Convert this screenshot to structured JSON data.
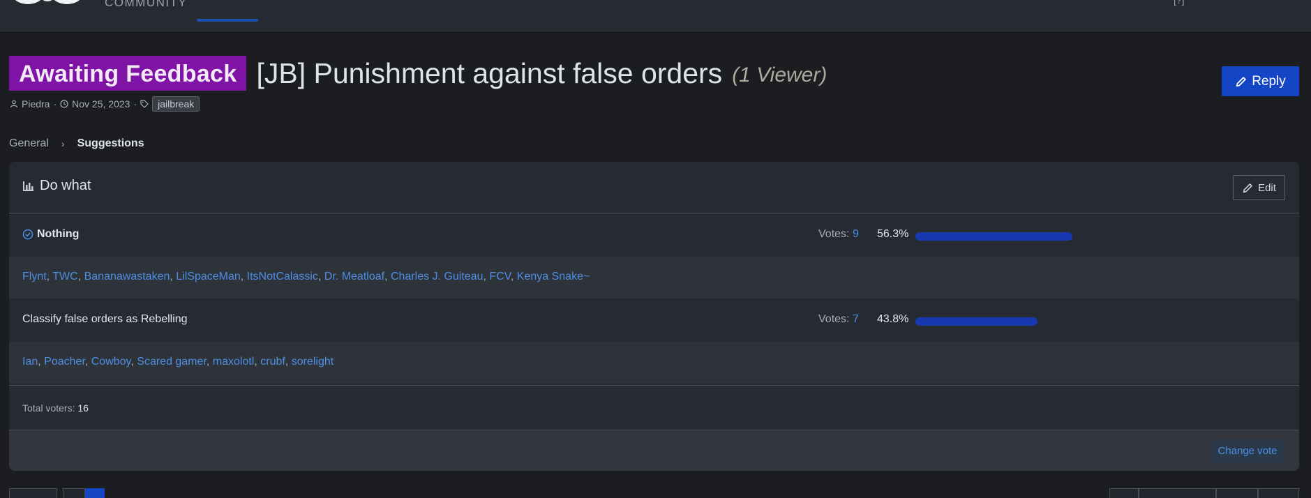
{
  "header": {
    "community_text": "COMMUNITY",
    "top_right_text": "[?]"
  },
  "thread": {
    "prefix_badge": "Awaiting Feedback",
    "title": "[JB] Punishment against false orders",
    "viewer_note": "(1 Viewer)",
    "reply_label": "Reply",
    "author": "Piedra",
    "separator": "·",
    "date": "Nov 25, 2023",
    "tag": "jailbreak"
  },
  "breadcrumb": {
    "items": [
      "General",
      "Suggestions"
    ]
  },
  "poll": {
    "question": "Do what",
    "edit_label": "Edit",
    "votes_label": "Votes:",
    "options": [
      {
        "label": "Nothing",
        "votes": "9",
        "percent": "56.3%",
        "fraction": 0.563,
        "voted": true,
        "voters": [
          "Flynt",
          "TWC",
          "Bananawastaken",
          "LilSpaceMan",
          "ItsNotCalassic",
          "Dr. Meatloaf",
          "Charles J. Guiteau",
          "FCV",
          "Kenya Snake~"
        ]
      },
      {
        "label": "Classify false orders as Rebelling",
        "votes": "7",
        "percent": "43.8%",
        "fraction": 0.438,
        "voted": false,
        "voters": [
          "Ian",
          "Poacher",
          "Cowboy",
          "Scared gamer",
          "maxolotl",
          "crubf",
          "sorelight"
        ]
      }
    ],
    "total_label": "Total voters:",
    "total_value": "16",
    "change_vote_label": "Change vote"
  },
  "colors": {
    "badge": "#7e13a6",
    "accent": "#1445c5",
    "link": "#4d8fe6",
    "bar": "#1639b0"
  }
}
